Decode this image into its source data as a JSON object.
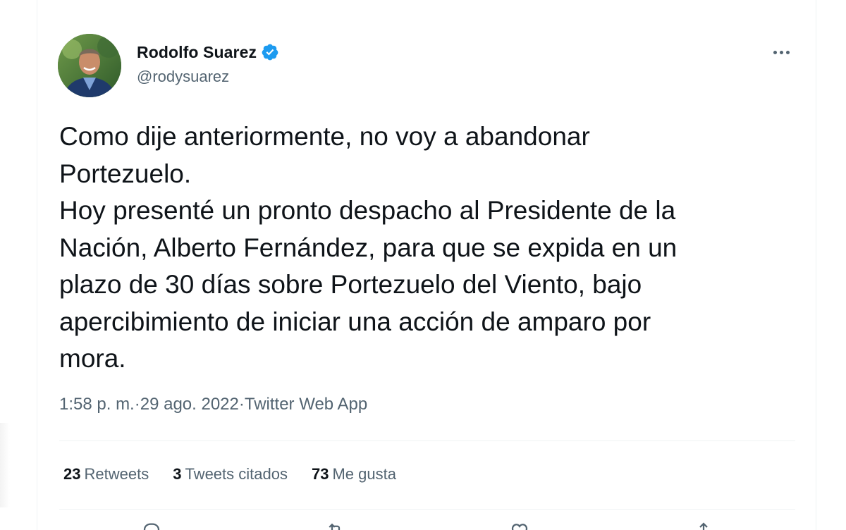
{
  "tweet": {
    "author": {
      "display_name": "Rodolfo Suarez",
      "handle": "@rodysuarez",
      "verified_icon": "verified-badge-icon",
      "avatar_icon": "profile-photo"
    },
    "more_icon": "more-options-icon",
    "text": "Como dije anteriormente, no voy a abandonar\nPortezuelo.\nHoy presenté un pronto despacho al Presidente de la\nNación, Alberto Fernández, para que se expida en un\nplazo de 30 días sobre Portezuelo del Viento, bajo\napercibimiento de iniciar una acción de amparo por\nmora.",
    "meta": {
      "time": "1:58 p. m.",
      "separator": " · ",
      "date": "29 ago. 2022",
      "source": "Twitter Web App"
    },
    "stats": {
      "retweets_count": "23",
      "retweets_label": "Retweets",
      "quotes_count": "3",
      "quotes_label": "Tweets citados",
      "likes_count": "73",
      "likes_label": "Me gusta"
    },
    "actions": [
      "reply-icon",
      "retweet-icon",
      "like-icon",
      "share-icon"
    ]
  },
  "colors": {
    "text_primary": "#0f1419",
    "text_secondary": "#536471",
    "verified_blue": "#1d9bf0",
    "divider": "#eff3f4"
  }
}
